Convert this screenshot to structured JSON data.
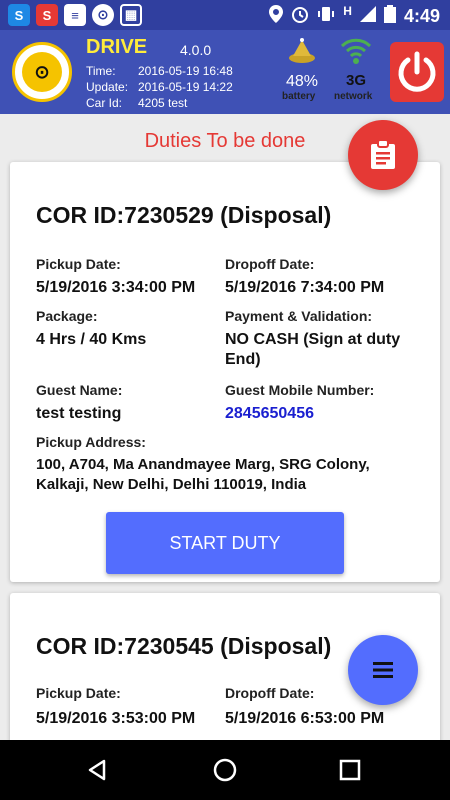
{
  "statusbar": {
    "time": "4:49",
    "network_type": "H",
    "apps": [
      "S",
      "S",
      "≡",
      "⊙",
      "▦"
    ]
  },
  "header": {
    "app_name": "DRIVE",
    "version": "4.0.0",
    "time_label": "Time:",
    "time_value": "2016-05-19 16:48",
    "update_label": "Update:",
    "update_value": "2016-05-19 14:22",
    "carid_label": "Car Id:",
    "carid_value": "4205 test",
    "battery_pct": "48%",
    "battery_label": "battery",
    "network_value": "3G",
    "network_label": "network",
    "accent": "#3f51b5",
    "power_color": "#e53935"
  },
  "title": "Duties To be done",
  "duties": [
    {
      "cor": "COR ID:7230529  (Disposal)",
      "pickup_date_label": "Pickup Date:",
      "pickup_date": "5/19/2016 3:34:00 PM",
      "dropoff_date_label": "Dropoff Date:",
      "dropoff_date": "5/19/2016 7:34:00 PM",
      "package_label": "Package:",
      "package": "4 Hrs / 40 Kms",
      "payment_label": "Payment & Validation:",
      "payment": "NO CASH (Sign at duty End)",
      "guest_name_label": "Guest Name:",
      "guest_name": "test testing",
      "guest_mobile_label": "Guest Mobile Number:",
      "guest_mobile": "2845650456",
      "pickup_address_label": "Pickup Address:",
      "pickup_address": "100, A704, Ma Anandmayee Marg, SRG Colony, Kalkaji, New Delhi, Delhi 110019, India",
      "button": "START DUTY"
    },
    {
      "cor": "COR ID:7230545  (Disposal)",
      "pickup_date_label": "Pickup Date:",
      "pickup_date": "5/19/2016 3:53:00 PM",
      "dropoff_date_label": "Dropoff Date:",
      "dropoff_date": "5/19/2016 6:53:00 PM"
    }
  ]
}
